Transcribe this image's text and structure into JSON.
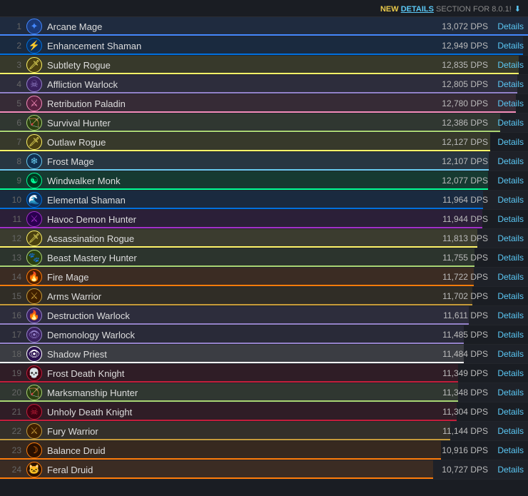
{
  "banner": {
    "prefix": "NEW ",
    "link_text": "DETAILS",
    "suffix": " SECTION FOR 8.0.1!",
    "download_icon": "⬇"
  },
  "details_label": "Details",
  "specs": [
    {
      "rank": 1,
      "name": "Arcane Mage",
      "dps": "13,072 DPS",
      "bar_color": "#4488ff",
      "underline": "#4488ff",
      "bar_pct": 100,
      "icon_char": "✦",
      "icon_bg": "#1a3a7a"
    },
    {
      "rank": 2,
      "name": "Enhancement Shaman",
      "dps": "12,949 DPS",
      "bar_color": "#0070de",
      "underline": "#0070de",
      "bar_pct": 99,
      "icon_char": "⚡",
      "icon_bg": "#0a3060"
    },
    {
      "rank": 3,
      "name": "Subtlety Rogue",
      "dps": "12,835 DPS",
      "bar_color": "#fff468",
      "underline": "#fff468",
      "bar_pct": 98,
      "icon_char": "🗡",
      "icon_bg": "#4a4010"
    },
    {
      "rank": 4,
      "name": "Affliction Warlock",
      "dps": "12,805 DPS",
      "bar_color": "#9482c9",
      "underline": "#9482c9",
      "bar_pct": 97,
      "icon_char": "☠",
      "icon_bg": "#3a2060"
    },
    {
      "rank": 5,
      "name": "Retribution Paladin",
      "dps": "12,780 DPS",
      "bar_color": "#f58cba",
      "underline": "#f58cba",
      "bar_pct": 97,
      "icon_char": "⚔",
      "icon_bg": "#5a2040"
    },
    {
      "rank": 6,
      "name": "Survival Hunter",
      "dps": "12,386 DPS",
      "bar_color": "#abd473",
      "underline": "#abd473",
      "bar_pct": 94,
      "icon_char": "🏹",
      "icon_bg": "#2a4010"
    },
    {
      "rank": 7,
      "name": "Outlaw Rogue",
      "dps": "12,127 DPS",
      "bar_color": "#fff468",
      "underline": "#fff468",
      "bar_pct": 92,
      "icon_char": "🗡",
      "icon_bg": "#4a4010"
    },
    {
      "rank": 8,
      "name": "Frost Mage",
      "dps": "12,107 DPS",
      "bar_color": "#69ccf0",
      "underline": "#69ccf0",
      "bar_pct": 92,
      "icon_char": "❄",
      "icon_bg": "#103050"
    },
    {
      "rank": 9,
      "name": "Windwalker Monk",
      "dps": "12,077 DPS",
      "bar_color": "#00ff96",
      "underline": "#00ff96",
      "bar_pct": 92,
      "icon_char": "☯",
      "icon_bg": "#003820"
    },
    {
      "rank": 10,
      "name": "Elemental Shaman",
      "dps": "11,964 DPS",
      "bar_color": "#0070de",
      "underline": "#0070de",
      "bar_pct": 91,
      "icon_char": "🌊",
      "icon_bg": "#0a3060"
    },
    {
      "rank": 11,
      "name": "Havoc Demon Hunter",
      "dps": "11,944 DPS",
      "bar_color": "#a330c9",
      "underline": "#a330c9",
      "bar_pct": 91,
      "icon_char": "⚔",
      "icon_bg": "#2a0050"
    },
    {
      "rank": 12,
      "name": "Assassination Rogue",
      "dps": "11,813 DPS",
      "bar_color": "#fff468",
      "underline": "#fff468",
      "bar_pct": 90,
      "icon_char": "🗡",
      "icon_bg": "#4a4010"
    },
    {
      "rank": 13,
      "name": "Beast Mastery Hunter",
      "dps": "11,755 DPS",
      "bar_color": "#abd473",
      "underline": "#abd473",
      "bar_pct": 89,
      "icon_char": "🐾",
      "icon_bg": "#2a4010"
    },
    {
      "rank": 14,
      "name": "Fire Mage",
      "dps": "11,722 DPS",
      "bar_color": "#ff7c0a",
      "underline": "#ff7c0a",
      "bar_pct": 89,
      "icon_char": "🔥",
      "icon_bg": "#502000"
    },
    {
      "rank": 15,
      "name": "Arms Warrior",
      "dps": "11,702 DPS",
      "bar_color": "#c69b3a",
      "underline": "#c69b3a",
      "bar_pct": 89,
      "icon_char": "⚔",
      "icon_bg": "#402000"
    },
    {
      "rank": 16,
      "name": "Destruction Warlock",
      "dps": "11,611 DPS",
      "bar_color": "#9482c9",
      "underline": "#9482c9",
      "bar_pct": 88,
      "icon_char": "🔥",
      "icon_bg": "#3a2060"
    },
    {
      "rank": 17,
      "name": "Demonology Warlock",
      "dps": "11,485 DPS",
      "bar_color": "#9482c9",
      "underline": "#9482c9",
      "bar_pct": 87,
      "icon_char": "👁",
      "icon_bg": "#3a2060"
    },
    {
      "rank": 18,
      "name": "Shadow Priest",
      "dps": "11,484 DPS",
      "bar_color": "#ffffff",
      "underline": "#ffffff",
      "bar_pct": 87,
      "icon_char": "👁",
      "icon_bg": "#2a1050"
    },
    {
      "rank": 19,
      "name": "Frost Death Knight",
      "dps": "11,349 DPS",
      "bar_color": "#c41e3a",
      "underline": "#c41e3a",
      "bar_pct": 86,
      "icon_char": "💀",
      "icon_bg": "#400010"
    },
    {
      "rank": 20,
      "name": "Marksmanship Hunter",
      "dps": "11,348 DPS",
      "bar_color": "#abd473",
      "underline": "#abd473",
      "bar_pct": 86,
      "icon_char": "🏹",
      "icon_bg": "#2a4010"
    },
    {
      "rank": 21,
      "name": "Unholy Death Knight",
      "dps": "11,304 DPS",
      "bar_color": "#c41e3a",
      "underline": "#c41e3a",
      "bar_pct": 86,
      "icon_char": "☠",
      "icon_bg": "#400010"
    },
    {
      "rank": 22,
      "name": "Fury Warrior",
      "dps": "11,144 DPS",
      "bar_color": "#c69b3a",
      "underline": "#c69b3a",
      "bar_pct": 85,
      "icon_char": "⚔",
      "icon_bg": "#402000"
    },
    {
      "rank": 23,
      "name": "Balance Druid",
      "dps": "10,916 DPS",
      "bar_color": "#ff7c0a",
      "underline": "#ff7c0a",
      "bar_pct": 83,
      "icon_char": "☽",
      "icon_bg": "#2a1000"
    },
    {
      "rank": 24,
      "name": "Feral Druid",
      "dps": "10,727 DPS",
      "bar_color": "#ff7c0a",
      "underline": "#ff7c0a",
      "bar_pct": 82,
      "icon_char": "🐱",
      "icon_bg": "#2a1000"
    }
  ]
}
